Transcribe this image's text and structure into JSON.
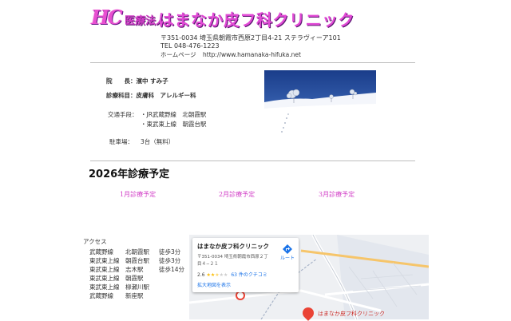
{
  "header": {
    "logo_mark": "HC",
    "logo_corp": "医療法人",
    "clinic_name": "はまなか皮フ科クリニック",
    "postal_address": "〒351-0034 埼玉県朝霞市西原2丁目4-21 ステラヴィーア101",
    "tel": "TEL 048-476-1223",
    "homepage_label": "ホームページ",
    "homepage_url": "http://www.hamanaka-hifuka.net"
  },
  "info": {
    "director_label": "院　　長：",
    "director_name": "濱中 すみ子",
    "departments_label": "診療科目：",
    "departments": "皮膚科　アレルギー科",
    "transport_label": "交通手段：",
    "transport_1": "・JR武蔵野線　北朝霞駅",
    "transport_2": "・東武東上線　朝霞台駅",
    "parking_label": "駐車場：",
    "parking_value": "3台（無料）"
  },
  "schedule": {
    "heading": "2026年診療予定",
    "links": [
      "1月診療予定",
      "2月診療予定",
      "3月診療予定"
    ]
  },
  "access": {
    "title": "アクセス",
    "rows": [
      [
        "武蔵野線",
        "北朝霞駅",
        "徒歩3分"
      ],
      [
        "東武東上線",
        "朝霞台駅",
        "徒歩3分"
      ],
      [
        "東武東上線",
        "志木駅",
        "徒歩14分"
      ],
      [
        "東武東上線",
        "朝霞駅",
        ""
      ],
      [
        "東武東上線",
        "柳瀬川駅",
        ""
      ],
      [
        "武蔵野線",
        "新座駅",
        ""
      ]
    ]
  },
  "map": {
    "place_name": "はまなか皮フ科クリニック",
    "address": "〒351-0034 埼玉県朝霞市西原２丁目４−２１",
    "rating": "2.6",
    "stars": 2.6,
    "review_link": "63 件のクチコミ",
    "enlarge_link": "拡大地図を表示",
    "route_label": "ルート",
    "marker_label": "はまなか皮フ科クリニック"
  },
  "colors": {
    "brand_pink": "#e24bd6",
    "schedule_pink": "#d23fc7",
    "link_blue": "#1a73e8",
    "marker_red": "#ea4335"
  }
}
